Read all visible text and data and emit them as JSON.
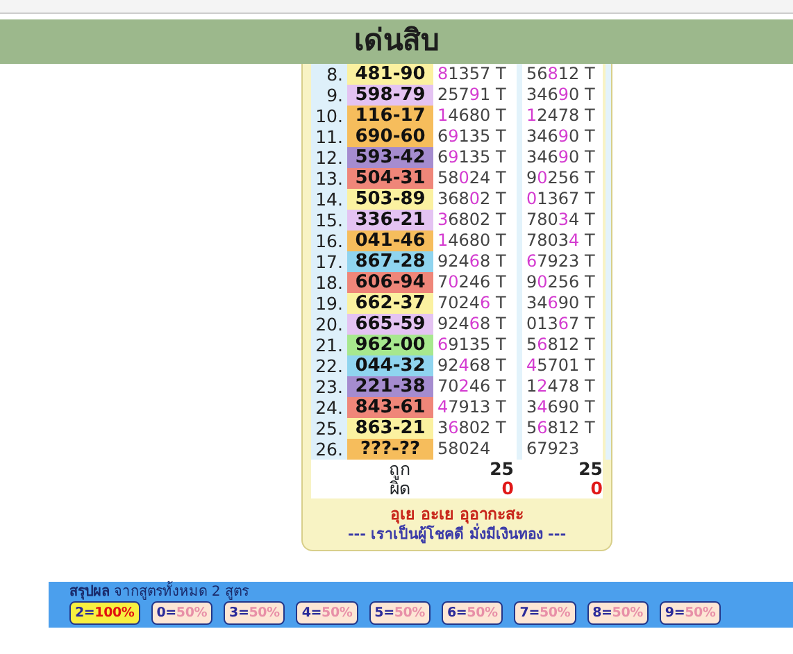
{
  "header": {
    "title": "เด่นสิบ"
  },
  "rows": [
    {
      "index": "8.",
      "pair": "481-90",
      "color": "#fbf1a0",
      "col_2": "**8**1357 T",
      "col_3": "56**8**12 T"
    },
    {
      "index": "9.",
      "pair": "598-79",
      "color": "#e4c3f2",
      "col_2": "257**9**1 T",
      "col_3": "346**9**0 T"
    },
    {
      "index": "10.",
      "pair": "116-17",
      "color": "#f6bd5c",
      "col_2": "**1**4680 T",
      "col_3": "**1**2478 T"
    },
    {
      "index": "11.",
      "pair": "690-60",
      "color": "#f6bd5c",
      "col_2": "6**9**135 T",
      "col_3": "346**9**0 T"
    },
    {
      "index": "12.",
      "pair": "593-42",
      "color": "#a58ccf",
      "col_2": "6**9**135 T",
      "col_3": "346**9**0 T"
    },
    {
      "index": "13.",
      "pair": "504-31",
      "color": "#ef8679",
      "col_2": "58**0**24 T",
      "col_3": "9**0**256 T"
    },
    {
      "index": "14.",
      "pair": "503-89",
      "color": "#fbf1a0",
      "col_2": "368**0**2 T",
      "col_3": "**0**1367 T"
    },
    {
      "index": "15.",
      "pair": "336-21",
      "color": "#e4c3f2",
      "col_2": "**3**6802 T",
      "col_3": "780**3**4 T"
    },
    {
      "index": "16.",
      "pair": "041-46",
      "color": "#f6bd5c",
      "col_2": "**1**4680 T",
      "col_3": "7803**4** T"
    },
    {
      "index": "17.",
      "pair": "867-28",
      "color": "#8fd4ef",
      "col_2": "924**6**8 T",
      "col_3": "**6**7923 T"
    },
    {
      "index": "18.",
      "pair": "606-94",
      "color": "#ef8679",
      "col_2": "7**0**246 T",
      "col_3": "9**0**256 T"
    },
    {
      "index": "19.",
      "pair": "662-37",
      "color": "#fbf1a0",
      "col_2": "7024**6** T",
      "col_3": "34**6**90 T"
    },
    {
      "index": "20.",
      "pair": "665-59",
      "color": "#e4c3f2",
      "col_2": "924**6**8 T",
      "col_3": "013**6**7 T"
    },
    {
      "index": "21.",
      "pair": "962-00",
      "color": "#a7e88e",
      "col_2": "**6**9135 T",
      "col_3": "5**6**812 T"
    },
    {
      "index": "22.",
      "pair": "044-32",
      "color": "#8fd4ef",
      "col_2": "92**4**68 T",
      "col_3": "**4**5701 T"
    },
    {
      "index": "23.",
      "pair": "221-38",
      "color": "#a58ccf",
      "col_2": "70**2**46 T",
      "col_3": "1**2**478 T"
    },
    {
      "index": "24.",
      "pair": "843-61",
      "color": "#ef8679",
      "col_2": "**4**7913 T",
      "col_3": "3**4**690 T"
    },
    {
      "index": "25.",
      "pair": "863-21",
      "color": "#fbf1a0",
      "col_2": "3**6**802 T",
      "col_3": "5**6**812 T"
    },
    {
      "index": "26.",
      "pair": "???-??",
      "color": "#f6bd5c",
      "col_2": "58024",
      "col_3": "67923"
    }
  ],
  "totals": [
    {
      "label": "ถูก",
      "kind": "correct",
      "col_2": "25",
      "col_3": "25"
    },
    {
      "label": "ผิด",
      "kind": "wrong",
      "col_2": "0",
      "col_3": "0"
    }
  ],
  "footer": {
    "chant": "อุเย อะเย อุอากะสะ",
    "blessing": "--- เราเป็นผู้โชคดี มั่งมีเงินทอง ---"
  },
  "summary": {
    "title": "**สรุปผล** จากสูตรทั้งหมด 2 สูตร",
    "results": [
      {
        "digit": "2=",
        "percent": "100%",
        "selected": true
      },
      {
        "digit": "0=",
        "percent": "50%",
        "selected": false
      },
      {
        "digit": "3=",
        "percent": "50%",
        "selected": false
      },
      {
        "digit": "4=",
        "percent": "50%",
        "selected": false
      },
      {
        "digit": "5=",
        "percent": "50%",
        "selected": false
      },
      {
        "digit": "6=",
        "percent": "50%",
        "selected": false
      },
      {
        "digit": "7=",
        "percent": "50%",
        "selected": false
      },
      {
        "digit": "8=",
        "percent": "50%",
        "selected": false
      },
      {
        "digit": "9=",
        "percent": "50%",
        "selected": false
      }
    ]
  }
}
